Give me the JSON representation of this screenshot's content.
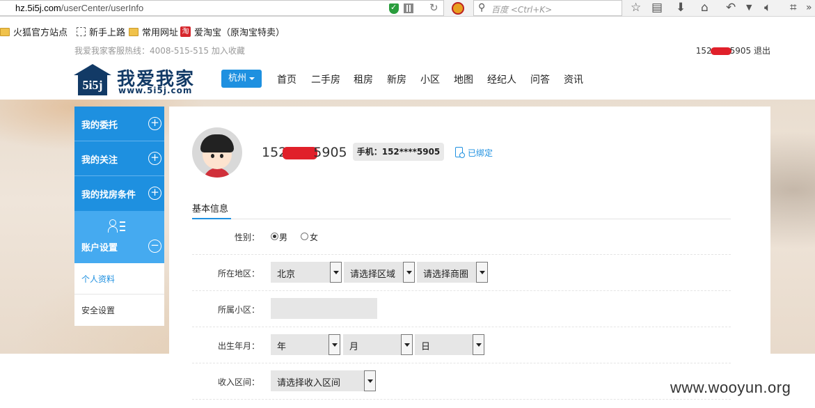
{
  "browser": {
    "url_domain": "hz.5i5j.com",
    "url_path": "/userCenter/userInfo",
    "search_placeholder": "百度 <Ctrl+K>",
    "bookmarks": [
      "火狐官方站点",
      "新手上路",
      "常用网址",
      "爱淘宝（原淘宝特卖）"
    ],
    "taobao_icon_char": "淘"
  },
  "header": {
    "hotline": "我爱我家客服热线：4008-515-515 加入收藏",
    "user_prefix": "152",
    "user_suffix": "5905",
    "logout": "退出",
    "logo_mark": "5i5j",
    "logo_name": "我爱我家",
    "logo_url": "www.5i5j.com",
    "city": "杭州",
    "nav": [
      "首页",
      "二手房",
      "租房",
      "新房",
      "小区",
      "地图",
      "经纪人",
      "问答",
      "资讯"
    ]
  },
  "sidebar": {
    "items": [
      {
        "label": "我的委托",
        "icon": "+"
      },
      {
        "label": "我的关注",
        "icon": "+"
      },
      {
        "label": "我的找房条件",
        "icon": "+"
      }
    ],
    "account": {
      "label": "账户设置",
      "icon": "−"
    },
    "sub_items": [
      "个人资料",
      "安全设置"
    ],
    "active_color": "#1e90e0"
  },
  "profile": {
    "phone_prefix": "152",
    "phone_suffix": "5905",
    "phone_badge": "手机：152****5905",
    "bind_status": "已绑定",
    "tab": "基本信息"
  },
  "form": {
    "gender_label": "性别：",
    "gender_options": [
      "男",
      "女"
    ],
    "gender_selected": "男",
    "region_label": "所在地区：",
    "region_city": "北京",
    "region_district": "请选择区域",
    "region_area": "请选择商圈",
    "community_label": "所属小区：",
    "community_value": "",
    "birth_label": "出生年月：",
    "birth_year": "年",
    "birth_month": "月",
    "birth_day": "日",
    "income_label": "收入区间：",
    "income_value": "请选择收入区间"
  },
  "watermark": "www.wooyun.org"
}
